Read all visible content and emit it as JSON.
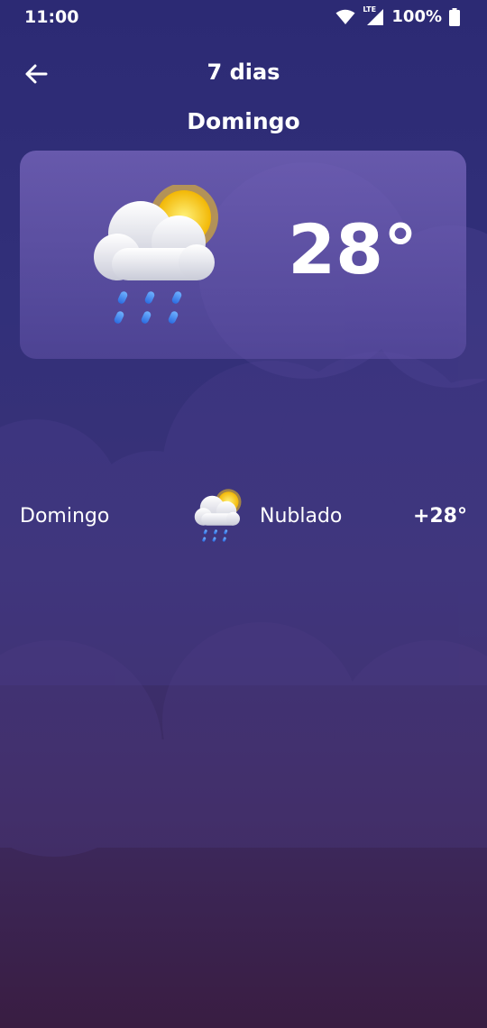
{
  "status_bar": {
    "time": "11:00",
    "network_label": "LTE",
    "battery_text": "100%"
  },
  "header": {
    "title": "7 dias"
  },
  "current": {
    "day": "Domingo",
    "temperature": "28°",
    "icon": "cloud-sun-rain-icon"
  },
  "forecast": [
    {
      "day": "Domingo",
      "condition": "Nublado",
      "temp": "+28°",
      "icon": "cloud-sun-rain-icon"
    }
  ],
  "colors": {
    "background_top": "#2c2a74",
    "background_bottom": "#391d42",
    "card": "#6f5fb4",
    "rain_drop": "#3a7dff",
    "sun": "#f5c518"
  }
}
